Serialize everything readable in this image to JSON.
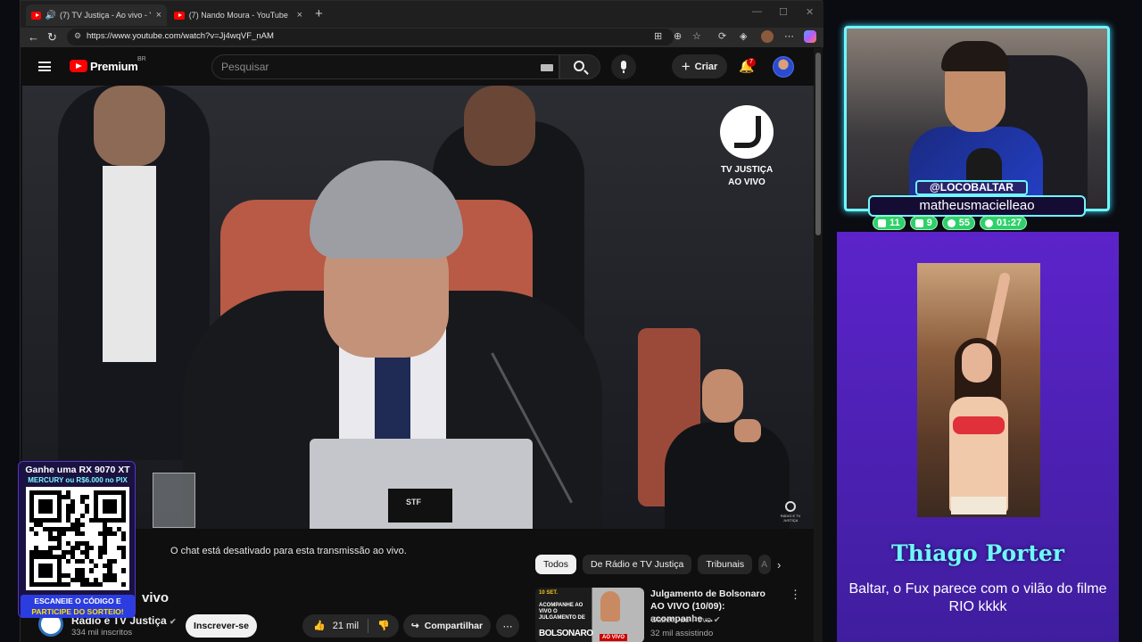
{
  "browser": {
    "tabs": [
      {
        "title": "(7) TV Justiça - Ao vivo - You",
        "active": true
      },
      {
        "title": "(7) Nando Moura - YouTube",
        "active": false
      }
    ],
    "new_tab": "+",
    "url": "https://www.youtube.com/watch?v=Jj4wqVF_nAM"
  },
  "youtube": {
    "brand": "Premium",
    "region": "BR",
    "search_placeholder": "Pesquisar",
    "create_label": "Criar",
    "notifications": "7"
  },
  "video": {
    "overlay_title": "TV JUSTIÇA",
    "overlay_sub": "AO VIVO",
    "laptop_label": "STF",
    "corner_text": "RÁDIO E TV JUSTIÇA"
  },
  "below": {
    "chat_disabled": "O chat está desativado para esta transmissão ao vivo.",
    "title_fragment": "vivo",
    "channel_name": "Rádio e TV Justiça",
    "subscribers": "334 mil inscritos",
    "subscribe_label": "Inscrever-se",
    "likes": "21 mil",
    "share_label": "Compartilhar",
    "chips": [
      "Todos",
      "De Rádio e TV Justiça",
      "Tribunais",
      "A"
    ]
  },
  "recommendation": {
    "title": "Julgamento de Bolsonaro AO VIVO (10/09): acompanhe ...",
    "channel": "Gazeta do Povo",
    "views": "32 mil assistindo",
    "thumb_date": "10 SET.",
    "thumb_caption": "ACOMPANHE AO VIVO O JULGAMENTO DE",
    "thumb_name": "BOLSONARO",
    "thumb_live": "AO VIVO"
  },
  "giveaway": {
    "line1": "Ganhe uma RX 9070 XT",
    "line2": "MERCURY ou R$6.000 no PIX",
    "cta1": "ESCANEIE O CÓDIGO E",
    "cta2": "PARTICIPE DO SORTEIO!"
  },
  "stream": {
    "handle": "@LOCOBALTAR",
    "subscriber": "matheusmacielleao",
    "stats": [
      {
        "icon": "twitch-icon",
        "value": "11"
      },
      {
        "icon": "youtube-icon",
        "value": "9"
      },
      {
        "icon": "kick-icon",
        "value": "55"
      },
      {
        "icon": "clock-icon",
        "value": "01:27"
      }
    ],
    "donor_name": "Thiago Porter",
    "donor_message": "Baltar, o Fux parece com o vilão do filme RIO kkkk"
  },
  "colors": {
    "accent_cyan": "#6ff7ff",
    "youtube_red": "#ff0000",
    "panel_purple": "#5a23c8",
    "stat_green": "#2fd06a"
  }
}
